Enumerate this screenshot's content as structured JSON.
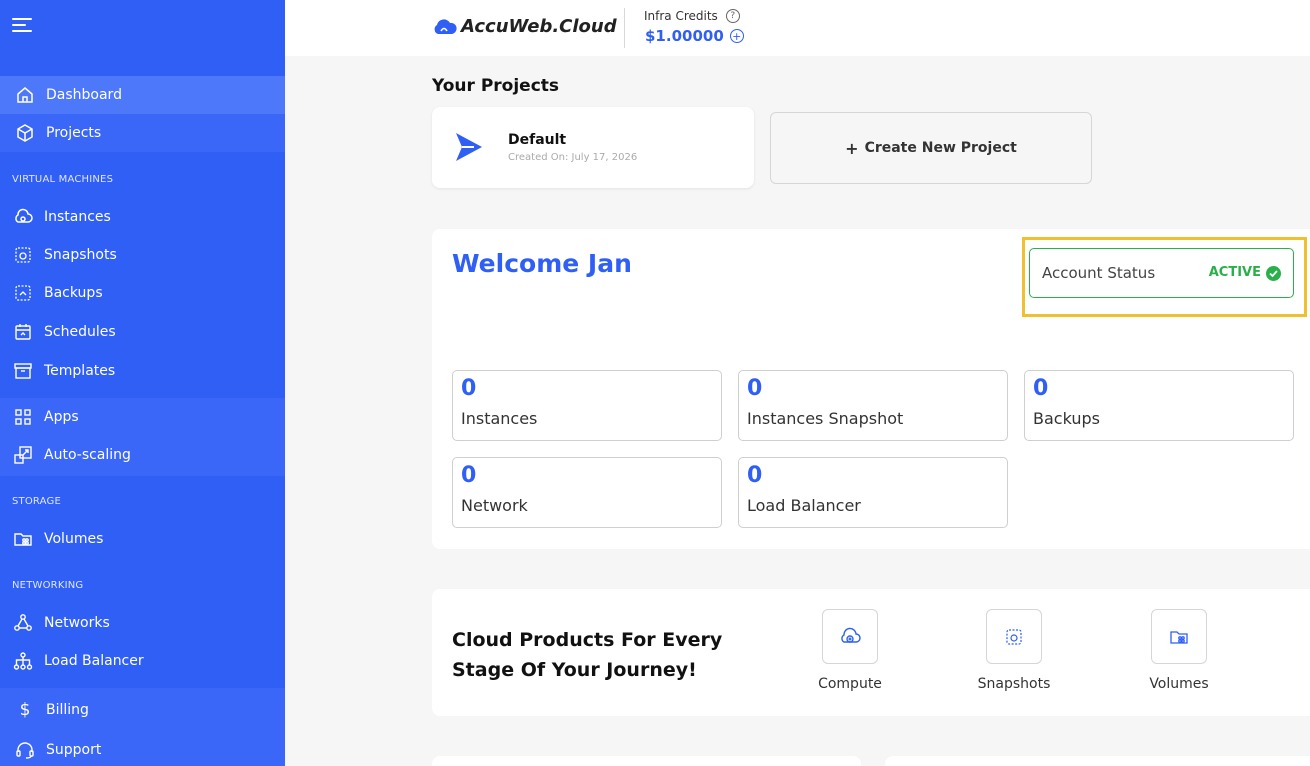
{
  "sidebar": {
    "items": [
      {
        "label": "Dashboard",
        "icon": "home-icon"
      },
      {
        "label": "Projects",
        "icon": "cube-icon"
      },
      {
        "label": "Instances",
        "icon": "cloud-icon"
      },
      {
        "label": "Snapshots",
        "icon": "snapshot-icon"
      },
      {
        "label": "Backups",
        "icon": "backup-icon"
      },
      {
        "label": "Schedules",
        "icon": "schedule-icon"
      },
      {
        "label": "Templates",
        "icon": "template-icon"
      },
      {
        "label": "Apps",
        "icon": "apps-icon"
      },
      {
        "label": "Auto-scaling",
        "icon": "autoscale-icon"
      },
      {
        "label": "Volumes",
        "icon": "volume-icon"
      },
      {
        "label": "Networks",
        "icon": "network-icon"
      },
      {
        "label": "Load Balancer",
        "icon": "loadbalancer-icon"
      },
      {
        "label": "Billing",
        "icon": "dollar-icon"
      },
      {
        "label": "Support",
        "icon": "headset-icon"
      }
    ],
    "sections": {
      "vm": "VIRTUAL MACHINES",
      "storage": "STORAGE",
      "networking": "NETWORKING"
    }
  },
  "header": {
    "logo": "AccuWeb.Cloud",
    "credits_label": "Infra Credits",
    "credits_value": "$1.00000"
  },
  "projects": {
    "title": "Your Projects",
    "items": [
      {
        "name": "Default",
        "created": "Created On: July 17, 2026"
      }
    ],
    "create_label": "Create New Project"
  },
  "welcome": {
    "title": "Welcome Jan",
    "account_status_label": "Account Status",
    "account_status_value": "ACTIVE",
    "stats": [
      {
        "value": "0",
        "label": "Instances"
      },
      {
        "value": "0",
        "label": "Instances Snapshot"
      },
      {
        "value": "0",
        "label": "Backups"
      },
      {
        "value": "0",
        "label": "Network"
      },
      {
        "value": "0",
        "label": "Load Balancer"
      }
    ]
  },
  "products": {
    "title": "Cloud Products For Every Stage Of Your Journey!",
    "items": [
      {
        "label": "Compute",
        "icon": "compute-icon"
      },
      {
        "label": "Snapshots",
        "icon": "snapshot-icon"
      },
      {
        "label": "Volumes",
        "icon": "volume-icon"
      }
    ]
  },
  "colors": {
    "sidebar": "#2f5ff5",
    "accent": "#2f5ff5",
    "active_green": "#2ab04a",
    "highlight": "#f0c030"
  }
}
